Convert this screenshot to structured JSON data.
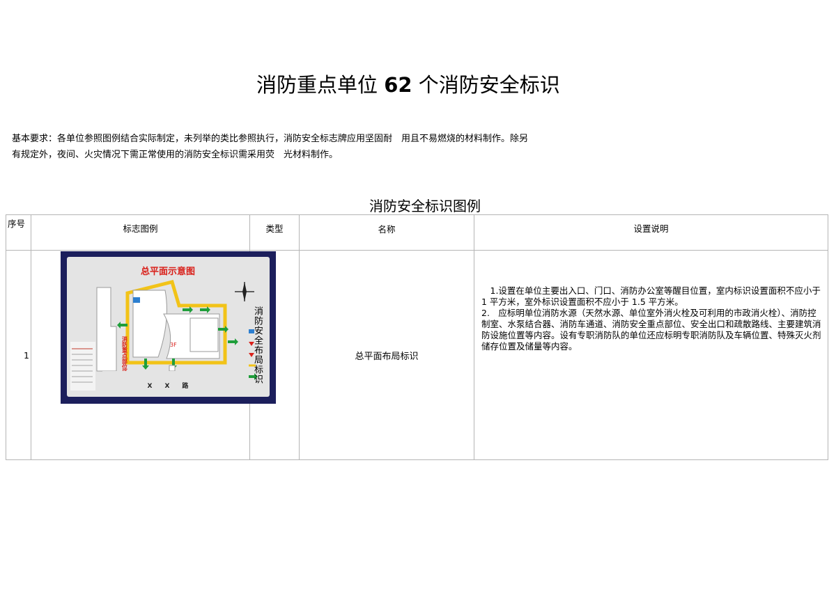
{
  "document": {
    "title_part1": "消防重点单位 ",
    "title_number": "62",
    "title_part2": " 个消防安全标识",
    "requirement_line1": "基本要求：各单位参照图例结合实际制定，未列举的类比参照执行，消防安全标志牌应用坚固耐　用且不易燃烧的材料制作。除另",
    "requirement_line2": "有规定外，夜间、火灾情况下需正常使用的消防安全标识需采用荧　光材料制作。",
    "table_caption": "消防安全标识图例"
  },
  "table": {
    "headers": {
      "seq": "序号",
      "sign": "标志图例",
      "type": "类型",
      "name": "名称",
      "desc": "设置说明"
    },
    "rows": [
      {
        "seq": "1",
        "type": "消防安全布局标识",
        "name": "总平面布局标识",
        "desc_1": "　1.设置在单位主要出入口、门口、消防办公室等醒目位置，室内标识设置面积不应小于 1 平方米，室外标识设置面积不应小于 1.5 平方米。",
        "desc_2": "2.　应标明单位消防水源（天然水源、单位室外消火栓及可利用的市政消火栓）、消防控制室、水泵结合器、消防车通道、消防安全重点部位、安全出口和疏散路线、主要建筑消防设施位置等内容。设有专职消防队的单位还应标明专职消防队及车辆位置、特殊灭火剂储存位置及储量等内容。",
        "sign": {
          "title": "总平面示意图",
          "road_label": "X　　X　　路",
          "building_label": "3F",
          "vertical_label": "消防重点部位场地"
        }
      }
    ]
  },
  "colors": {
    "sign_border": "#1c1f5c",
    "sign_bg": "#e4e4e4",
    "route": "#f2c318",
    "sign_title": "#d9201a",
    "exit_arrow": "#1e9e3a",
    "table_border": "#b5b5b5"
  }
}
